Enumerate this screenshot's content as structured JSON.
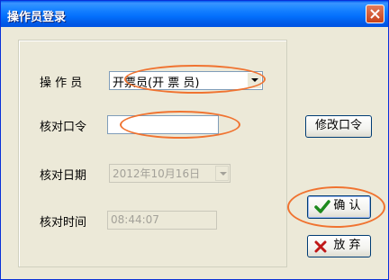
{
  "window": {
    "title": "操作员登录"
  },
  "form": {
    "operator_label": "操 作 员",
    "operator_value": "开票员(开 票 员)",
    "password_label": "核对口令",
    "password_value": "",
    "date_label": "核对日期",
    "date_value": "2012年10月16日",
    "time_label": "核对时间",
    "time_value": "08:44:07"
  },
  "buttons": {
    "change_password": "修改口令",
    "confirm": "确 认",
    "cancel": "放 弃"
  },
  "colors": {
    "annotation": "#f07330",
    "titlebar": "#0054e3"
  }
}
